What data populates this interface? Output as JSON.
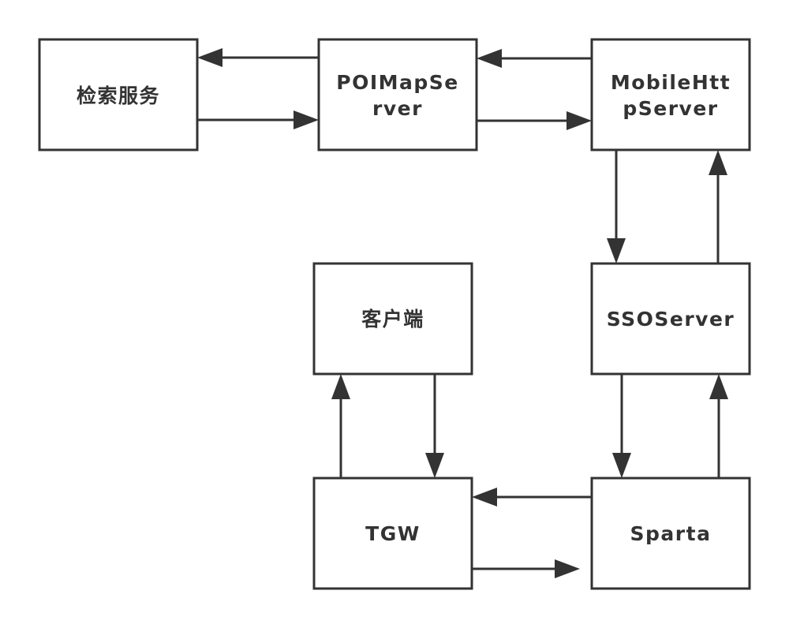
{
  "diagram": {
    "nodes": {
      "search_service": {
        "label": "检索服务"
      },
      "poi_map_server": {
        "label_line1": "POIMapSe",
        "label_line2": "rver"
      },
      "mobile_http_server": {
        "label_line1": "MobileHtt",
        "label_line2": "pServer"
      },
      "sso_server": {
        "label": "SSOServer"
      },
      "client": {
        "label": "客户端"
      },
      "tgw": {
        "label": "TGW"
      },
      "sparta": {
        "label": "Sparta"
      }
    },
    "edges": [
      {
        "from": "poi_map_server",
        "to": "search_service"
      },
      {
        "from": "search_service",
        "to": "poi_map_server"
      },
      {
        "from": "mobile_http_server",
        "to": "poi_map_server"
      },
      {
        "from": "poi_map_server",
        "to": "mobile_http_server"
      },
      {
        "from": "mobile_http_server",
        "to": "sso_server"
      },
      {
        "from": "sso_server",
        "to": "mobile_http_server"
      },
      {
        "from": "sso_server",
        "to": "sparta"
      },
      {
        "from": "sparta",
        "to": "sso_server"
      },
      {
        "from": "sparta",
        "to": "tgw"
      },
      {
        "from": "tgw",
        "to": "sparta"
      },
      {
        "from": "tgw",
        "to": "client"
      },
      {
        "from": "client",
        "to": "tgw"
      }
    ]
  }
}
